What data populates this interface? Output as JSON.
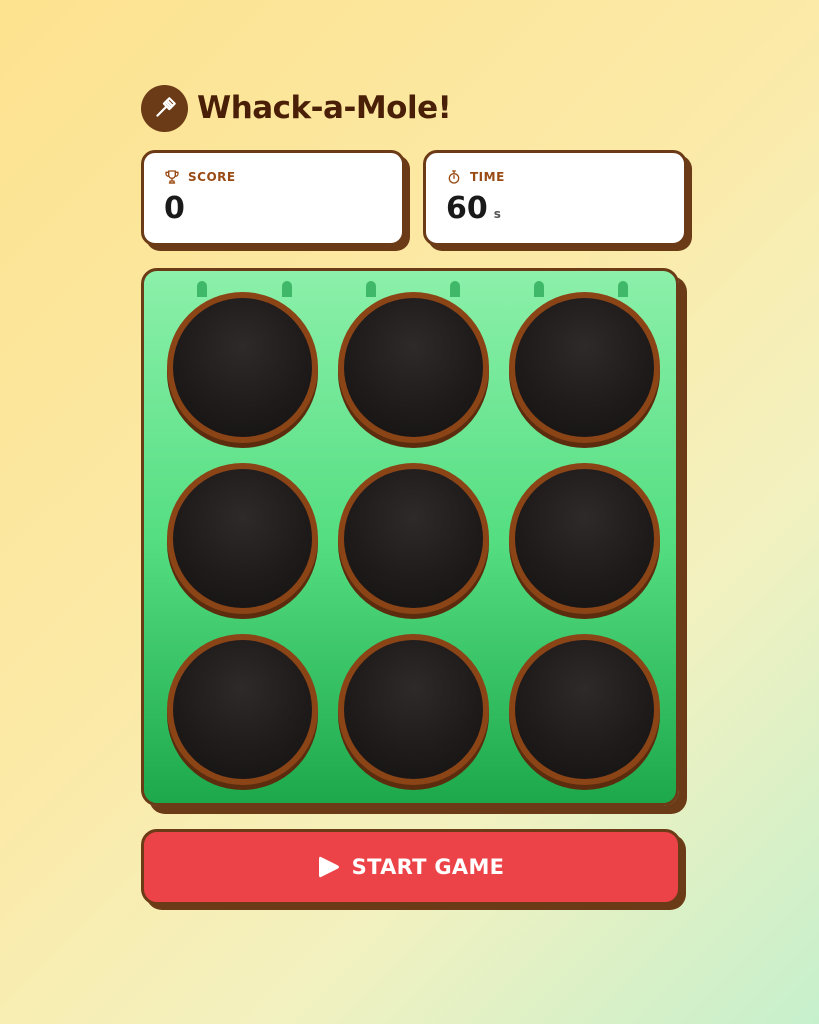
{
  "header": {
    "title": "Whack-a-Mole!",
    "logo_icon": "hammer-icon"
  },
  "stats": {
    "score": {
      "label": "SCORE",
      "value": "0",
      "icon": "trophy-icon"
    },
    "time": {
      "label": "TIME",
      "value": "60",
      "unit": "s",
      "icon": "stopwatch-icon"
    }
  },
  "board": {
    "rows": 3,
    "cols": 3,
    "holes": [
      {
        "id": 1,
        "mole_visible": false
      },
      {
        "id": 2,
        "mole_visible": false
      },
      {
        "id": 3,
        "mole_visible": false
      },
      {
        "id": 4,
        "mole_visible": false
      },
      {
        "id": 5,
        "mole_visible": false
      },
      {
        "id": 6,
        "mole_visible": false
      },
      {
        "id": 7,
        "mole_visible": false
      },
      {
        "id": 8,
        "mole_visible": false
      },
      {
        "id": 9,
        "mole_visible": false
      }
    ]
  },
  "controls": {
    "start_label": "START GAME",
    "start_icon": "play-icon"
  },
  "colors": {
    "brown": "#6b3a16",
    "button_red": "#ec4348",
    "grass_green": "#55de82"
  }
}
